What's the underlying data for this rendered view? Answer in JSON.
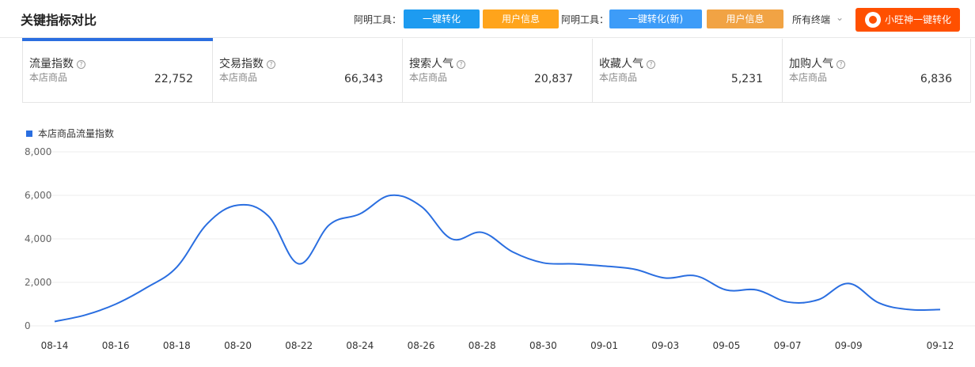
{
  "header": {
    "title": "关键指标对比",
    "tool_label_1": "阿明工具：",
    "btn_convert": "一键转化",
    "btn_user_info": "用户信息",
    "tool_label_2": "阿明工具：",
    "btn_convert_new": "一键转化(新)",
    "btn_user_info_2": "用户信息",
    "terminal_select": "所有终端",
    "btn_wangshen": "小旺神一键转化"
  },
  "metrics": [
    {
      "name": "流量指数",
      "sub": "本店商品",
      "value": "22,752"
    },
    {
      "name": "交易指数",
      "sub": "本店商品",
      "value": "66,343"
    },
    {
      "name": "搜索人气",
      "sub": "本店商品",
      "value": "20,837"
    },
    {
      "name": "收藏人气",
      "sub": "本店商品",
      "value": "5,231"
    },
    {
      "name": "加购人气",
      "sub": "本店商品",
      "value": "6,836"
    }
  ],
  "colors": {
    "accent": "#2a6ee0",
    "blue_button": "#1d9bf0",
    "orange_button": "#ffa41b",
    "wangshen_button": "#ff5000"
  },
  "chart_data": {
    "type": "line",
    "title": "",
    "xlabel": "",
    "ylabel": "",
    "ylim": [
      0,
      8000
    ],
    "yticks": [
      "8,000",
      "6,000",
      "4,000",
      "2,000",
      "0"
    ],
    "grid": true,
    "legend": "top-left",
    "x_tick_labels": [
      "08-14",
      "08-16",
      "08-18",
      "08-20",
      "08-22",
      "08-24",
      "08-26",
      "08-28",
      "08-30",
      "09-01",
      "09-03",
      "09-05",
      "09-07",
      "09-09",
      "09-12"
    ],
    "series": [
      {
        "name": "本店商品流量指数",
        "color": "#2a6ee0",
        "x": [
          "08-14",
          "08-15",
          "08-16",
          "08-17",
          "08-18",
          "08-19",
          "08-20",
          "08-21",
          "08-22",
          "08-23",
          "08-24",
          "08-25",
          "08-26",
          "08-27",
          "08-28",
          "08-29",
          "08-30",
          "08-31",
          "09-01",
          "09-02",
          "09-03",
          "09-04",
          "09-05",
          "09-06",
          "09-07",
          "09-08",
          "09-09",
          "09-10",
          "09-11",
          "09-12"
        ],
        "values": [
          200,
          500,
          1000,
          1750,
          2700,
          4700,
          5550,
          5050,
          2850,
          4650,
          5150,
          6000,
          5500,
          4000,
          4300,
          3400,
          2900,
          2850,
          2750,
          2600,
          2200,
          2300,
          1650,
          1650,
          1100,
          1200,
          1950,
          1050,
          750,
          750
        ]
      }
    ]
  }
}
